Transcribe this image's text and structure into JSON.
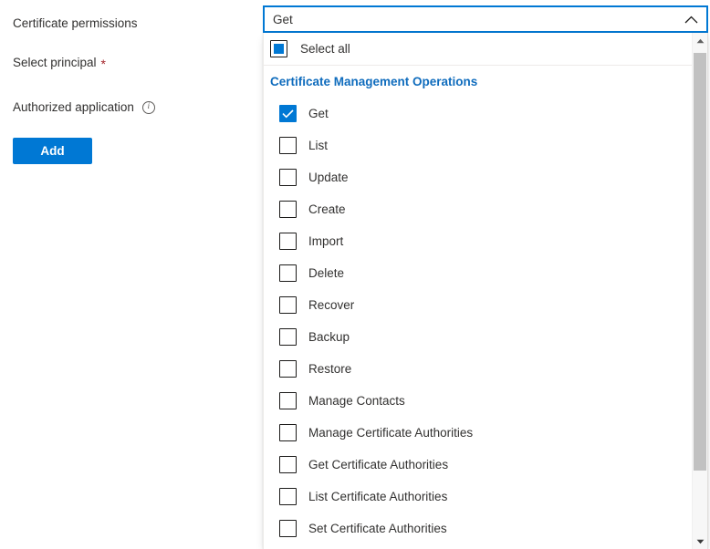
{
  "form": {
    "fields": [
      {
        "label": "Certificate permissions",
        "required": false,
        "has_info": false
      },
      {
        "label": "Select principal",
        "required": true,
        "has_info": false
      },
      {
        "label": "Authorized application",
        "required": false,
        "has_info": true
      }
    ],
    "required_marker": "*",
    "info_glyph": "i",
    "add_button_label": "Add"
  },
  "combobox": {
    "value": "Get",
    "expanded": true,
    "chevron_icon": "chevron-up-icon",
    "accent_color": "#0078d4"
  },
  "dropdown": {
    "select_all": {
      "label": "Select all",
      "state": "indeterminate"
    },
    "group": {
      "title": "Certificate Management Operations",
      "title_color": "#0f6cbd"
    },
    "options": [
      {
        "label": "Get",
        "checked": true
      },
      {
        "label": "List",
        "checked": false
      },
      {
        "label": "Update",
        "checked": false
      },
      {
        "label": "Create",
        "checked": false
      },
      {
        "label": "Import",
        "checked": false
      },
      {
        "label": "Delete",
        "checked": false
      },
      {
        "label": "Recover",
        "checked": false
      },
      {
        "label": "Backup",
        "checked": false
      },
      {
        "label": "Restore",
        "checked": false
      },
      {
        "label": "Manage Contacts",
        "checked": false
      },
      {
        "label": "Manage Certificate Authorities",
        "checked": false
      },
      {
        "label": "Get Certificate Authorities",
        "checked": false
      },
      {
        "label": "List Certificate Authorities",
        "checked": false
      },
      {
        "label": "Set Certificate Authorities",
        "checked": false
      }
    ],
    "scrollbar": {
      "up_arrow_icon": "scroll-up-arrow-icon",
      "down_arrow_icon": "scroll-down-arrow-icon",
      "thumb_icon": "scrollbar-thumb"
    }
  }
}
